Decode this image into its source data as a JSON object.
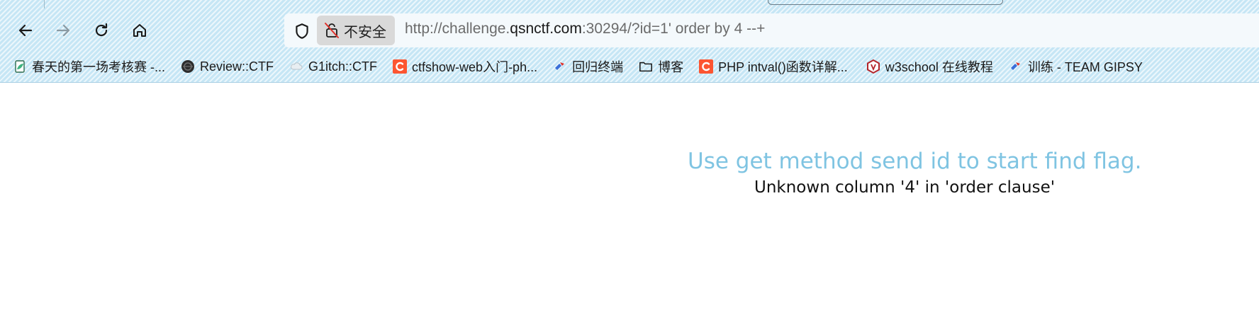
{
  "browser": {
    "nav": {
      "back": "back-icon",
      "forward": "forward-icon",
      "reload": "reload-icon",
      "home": "home-icon"
    },
    "urlbar": {
      "security_label": "不安全",
      "url_prefix": "http://challenge.",
      "url_domain": "qsnctf.com",
      "url_rest": ":30294/?id=1' order by 4 --+"
    },
    "bookmarks": [
      {
        "label": "春天的第一场考核赛 -...",
        "icon": "leaf-page-icon"
      },
      {
        "label": "Review::CTF",
        "icon": "dark-globe-icon"
      },
      {
        "label": "G1itch::CTF",
        "icon": "cloud-icon"
      },
      {
        "label": "ctfshow-web入门-ph...",
        "icon": "csdn-c-icon"
      },
      {
        "label": "回归终端",
        "icon": "flag-icon"
      },
      {
        "label": "博客",
        "icon": "folder-icon"
      },
      {
        "label": "PHP intval()函数详解...",
        "icon": "csdn-c-icon"
      },
      {
        "label": "w3school 在线教程",
        "icon": "w3school-icon"
      },
      {
        "label": "训练 - TEAM GIPSY",
        "icon": "flag-icon"
      }
    ],
    "colors": {
      "chrome_bg": "#d2ecf8",
      "hint_text": "#7fc4e2",
      "csdn_red": "#fc5531"
    }
  },
  "page": {
    "hint": "Use get method send id to start find flag.",
    "error": "Unknown column '4' in 'order clause'"
  }
}
